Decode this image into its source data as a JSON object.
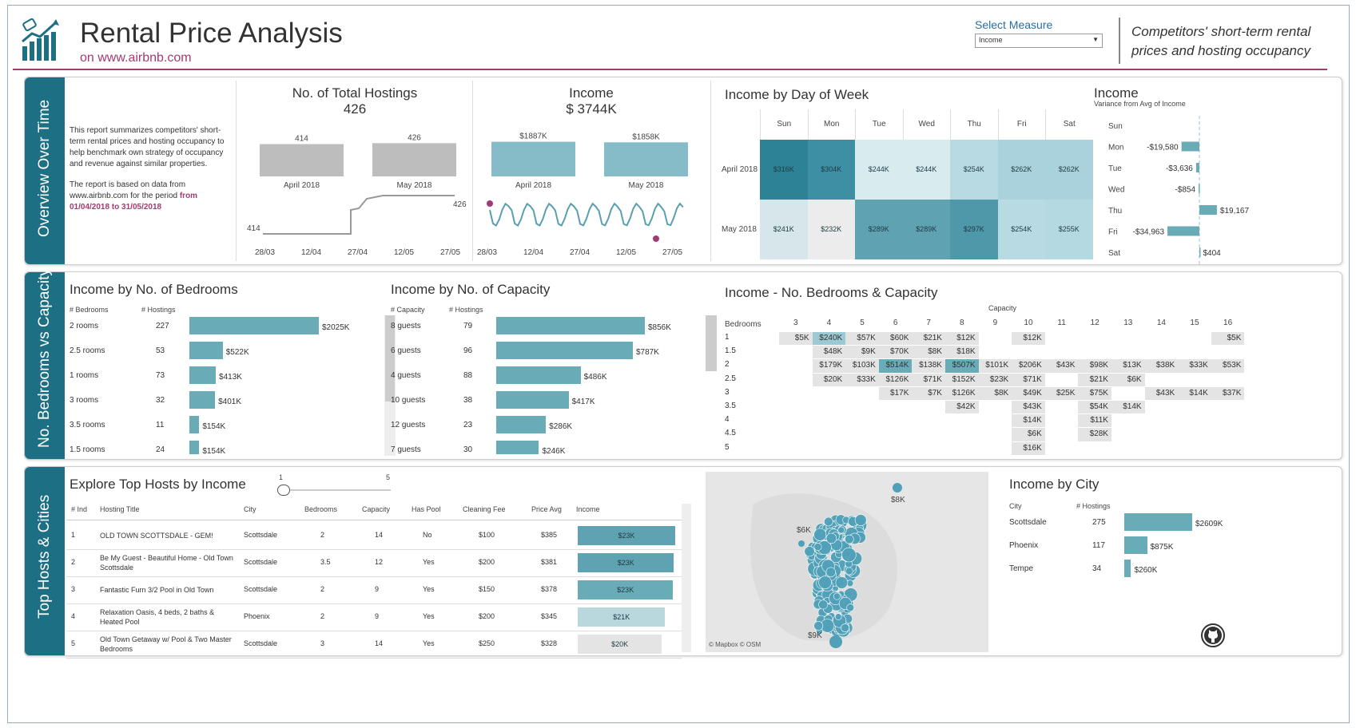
{
  "header": {
    "title": "Rental Price Analysis",
    "subtitle": "on www.airbnb.com",
    "measure_label": "Select Measure",
    "measure_value": "Income",
    "tagline": "Competitors' short-term rental prices and hosting occupancy",
    "colors": {
      "accent": "#a23b73",
      "tab": "#1d6f84",
      "bar": "#6aabb8"
    }
  },
  "tabs": {
    "overview": "Overview Over Time",
    "bedrooms": "No. Bedrooms vs Capacity",
    "hosts": "Top Hosts & Cities"
  },
  "intro": {
    "p1": "This report summarizes competitors' short-term rental prices and hosting occupancy to help benchmark own strategy of occupancy and revenue against similar properties.",
    "p2": "The report is based on data from www.airbnb.com for the period ",
    "p2_emph": "from 01/04/2018 to 31/05/2018"
  },
  "total_hostings": {
    "title": "No. of Total Hostings",
    "value": "426",
    "bars": [
      {
        "label": "April 2018",
        "value_label": "414",
        "value": 414
      },
      {
        "label": "May 2018",
        "value_label": "426",
        "value": 426
      }
    ],
    "start_label": "414",
    "end_label": "426",
    "x_ticks": [
      "28/03",
      "12/04",
      "27/04",
      "12/05",
      "27/05"
    ]
  },
  "income_total": {
    "title": "Income",
    "value": "$ 3744K",
    "bars": [
      {
        "label": "April 2018",
        "value_label": "$1887K",
        "value": 1887
      },
      {
        "label": "May 2018",
        "value_label": "$1858K",
        "value": 1858
      }
    ],
    "x_ticks": [
      "28/03",
      "12/04",
      "27/04",
      "12/05",
      "27/05"
    ]
  },
  "day_of_week": {
    "title": "Income by Day of Week",
    "days": [
      "Sun",
      "Mon",
      "Tue",
      "Wed",
      "Thu",
      "Fri",
      "Sat"
    ],
    "rows": [
      {
        "label": "April 2018",
        "values": [
          "$316K",
          "$304K",
          "$244K",
          "$244K",
          "$254K",
          "$262K",
          "$262K"
        ],
        "shades": [
          "#2e8296",
          "#3e8fa3",
          "#d8ecf0",
          "#d8ecf0",
          "#b8dbe3",
          "#a9d2dc",
          "#a9d2dc"
        ]
      },
      {
        "label": "May 2018",
        "values": [
          "$241K",
          "$232K",
          "$289K",
          "$289K",
          "$297K",
          "$254K",
          "$255K"
        ],
        "shades": [
          "#d6e6ea",
          "#ececec",
          "#5fa2b2",
          "#5fa2b2",
          "#4e98aa",
          "#b8dbe3",
          "#b5d9e1"
        ]
      }
    ]
  },
  "variance": {
    "title": "Income",
    "subtitle": "Variance from Avg of Income",
    "rows": [
      {
        "day": "Sun",
        "label": "",
        "value": 0
      },
      {
        "day": "Mon",
        "label": "-$19,580",
        "value": -19580
      },
      {
        "day": "Tue",
        "label": "-$3,636",
        "value": -3636
      },
      {
        "day": "Wed",
        "label": "-$854",
        "value": -854
      },
      {
        "day": "Thu",
        "label": "$19,167",
        "value": 19167
      },
      {
        "day": "Fri",
        "label": "-$34,963",
        "value": -34963
      },
      {
        "day": "Sat",
        "label": "$404",
        "value": 404
      }
    ]
  },
  "bedrooms": {
    "title": "Income by No. of Bedrooms",
    "col1": "# Bedrooms",
    "col2": "# Hostings",
    "rows": [
      {
        "name": "2 rooms",
        "hostings": "227",
        "label": "$2025K",
        "value": 2025
      },
      {
        "name": "2.5 rooms",
        "hostings": "53",
        "label": "$522K",
        "value": 522
      },
      {
        "name": "1 rooms",
        "hostings": "73",
        "label": "$413K",
        "value": 413
      },
      {
        "name": "3 rooms",
        "hostings": "32",
        "label": "$401K",
        "value": 401
      },
      {
        "name": "3.5 rooms",
        "hostings": "11",
        "label": "$154K",
        "value": 154
      },
      {
        "name": "1.5 rooms",
        "hostings": "24",
        "label": "$154K",
        "value": 154
      }
    ]
  },
  "capacity": {
    "title": "Income by No. of Capacity",
    "col1": "# Capacity",
    "col2": "# Hostings",
    "rows": [
      {
        "name": "8 guests",
        "hostings": "79",
        "label": "$856K",
        "value": 856
      },
      {
        "name": "6 guests",
        "hostings": "96",
        "label": "$787K",
        "value": 787
      },
      {
        "name": "4 guests",
        "hostings": "88",
        "label": "$486K",
        "value": 486
      },
      {
        "name": "10 guests",
        "hostings": "38",
        "label": "$417K",
        "value": 417
      },
      {
        "name": "12 guests",
        "hostings": "23",
        "label": "$286K",
        "value": 286
      },
      {
        "name": "7 guests",
        "hostings": "30",
        "label": "$246K",
        "value": 246
      }
    ]
  },
  "matrix": {
    "title": "Income - No. Bedrooms & Capacity",
    "col_title": "Capacity",
    "row_title": "Bedrooms",
    "cols": [
      "3",
      "4",
      "5",
      "6",
      "7",
      "8",
      "9",
      "10",
      "11",
      "12",
      "13",
      "14",
      "15",
      "16"
    ],
    "rows": [
      {
        "label": "1",
        "cells": [
          "$5K",
          "$240K",
          "$57K",
          "$60K",
          "$21K",
          "$12K",
          "",
          "$12K",
          "",
          "",
          "",
          "",
          "",
          "$5K"
        ]
      },
      {
        "label": "1.5",
        "cells": [
          "",
          "$48K",
          "$9K",
          "$70K",
          "$8K",
          "$18K",
          "",
          "",
          "",
          "",
          "",
          "",
          "",
          ""
        ]
      },
      {
        "label": "2",
        "cells": [
          "",
          "$179K",
          "$103K",
          "$514K",
          "$138K",
          "$507K",
          "$101K",
          "$206K",
          "$43K",
          "$98K",
          "$13K",
          "$38K",
          "$33K",
          "$53K"
        ]
      },
      {
        "label": "2.5",
        "cells": [
          "",
          "$20K",
          "$33K",
          "$126K",
          "$71K",
          "$152K",
          "$23K",
          "$71K",
          "",
          "$21K",
          "$6K",
          "",
          "",
          ""
        ]
      },
      {
        "label": "3",
        "cells": [
          "",
          "",
          "",
          "$17K",
          "$7K",
          "$126K",
          "$8K",
          "$49K",
          "$25K",
          "$75K",
          "",
          "$43K",
          "$14K",
          "$37K"
        ]
      },
      {
        "label": "3.5",
        "cells": [
          "",
          "",
          "",
          "",
          "",
          "$42K",
          "",
          "$43K",
          "",
          "$54K",
          "$14K",
          "",
          "",
          ""
        ]
      },
      {
        "label": "4",
        "cells": [
          "",
          "",
          "",
          "",
          "",
          "",
          "",
          "$14K",
          "",
          "$11K",
          "",
          "",
          "",
          ""
        ]
      },
      {
        "label": "4.5",
        "cells": [
          "",
          "",
          "",
          "",
          "",
          "",
          "",
          "$6K",
          "",
          "$28K",
          "",
          "",
          "",
          ""
        ]
      },
      {
        "label": "5",
        "cells": [
          "",
          "",
          "",
          "",
          "",
          "",
          "",
          "$16K",
          "",
          "",
          "",
          "",
          "",
          ""
        ]
      }
    ]
  },
  "top_hosts": {
    "title": "Explore Top Hosts by Income",
    "slider_min": "1",
    "slider_max": "5",
    "headers": [
      "# Ind",
      "Hosting Title",
      "City",
      "Bedrooms",
      "Capacity",
      "Has Pool",
      "Cleaning Fee",
      "Price Avg",
      "Income"
    ],
    "rows": [
      {
        "ind": "1",
        "title": "OLD TOWN SCOTTSDALE - GEM!",
        "city": "Scottsdale",
        "bedrooms": "2",
        "capacity": "14",
        "pool": "No",
        "fee": "$100",
        "price": "$385",
        "income": "$23K",
        "income_value": 23.4,
        "shade": "#5fa2b2"
      },
      {
        "ind": "2",
        "title": "Be My Guest - Beautiful Home - Old Town Scottsdale",
        "city": "Scottsdale",
        "bedrooms": "3.5",
        "capacity": "12",
        "pool": "Yes",
        "fee": "$200",
        "price": "$381",
        "income": "$23K",
        "income_value": 23.1,
        "shade": "#5fa2b2"
      },
      {
        "ind": "3",
        "title": "Fantastic Furn 3/2 Pool in Old Town",
        "city": "Scottsdale",
        "bedrooms": "2",
        "capacity": "9",
        "pool": "Yes",
        "fee": "$150",
        "price": "$378",
        "income": "$23K",
        "income_value": 22.9,
        "shade": "#6aabb8"
      },
      {
        "ind": "4",
        "title": "Relaxation Oasis, 4 beds, 2 baths & Heated Pool",
        "city": "Phoenix",
        "bedrooms": "2",
        "capacity": "9",
        "pool": "Yes",
        "fee": "$200",
        "price": "$345",
        "income": "$21K",
        "income_value": 21,
        "shade": "#b9d8de"
      },
      {
        "ind": "5",
        "title": "Old Town Getaway w/ Pool & Two Master Bedrooms",
        "city": "Scottsdale",
        "bedrooms": "3",
        "capacity": "14",
        "pool": "Yes",
        "fee": "$250",
        "price": "$328",
        "income": "$20K",
        "income_value": 20.2,
        "shade": "#e4e4e4"
      }
    ]
  },
  "map": {
    "labels": [
      "$8K",
      "$6K",
      "$9K"
    ],
    "attribution": "© Mapbox  © OSM"
  },
  "cities": {
    "title": "Income by City",
    "col1": "City",
    "col2": "# Hostings",
    "rows": [
      {
        "name": "Scottsdale",
        "hostings": "275",
        "label": "$2609K",
        "value": 2609
      },
      {
        "name": "Phoenix",
        "hostings": "117",
        "label": "$875K",
        "value": 875
      },
      {
        "name": "Tempe",
        "hostings": "34",
        "label": "$260K",
        "value": 260
      }
    ]
  }
}
